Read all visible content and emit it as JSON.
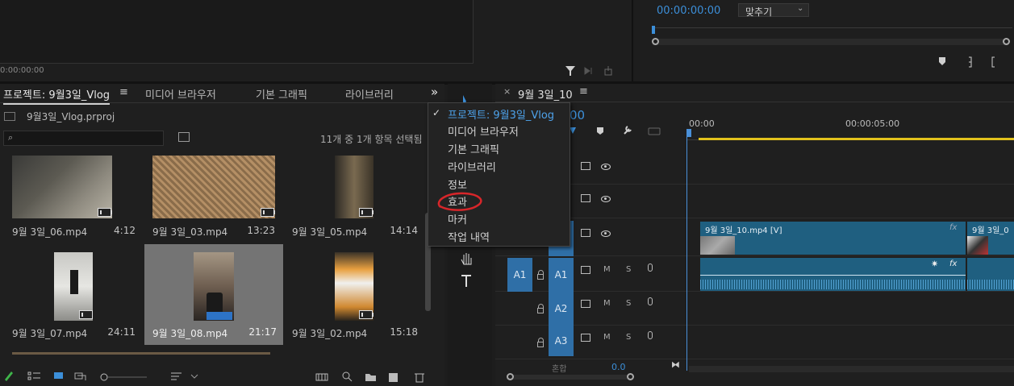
{
  "program_monitor": {
    "timecode": "00:00:00:00",
    "fit_label": "맞추기",
    "left_timecode": "0:00:00:00"
  },
  "project_panel": {
    "tabs": [
      {
        "label": "프로젝트: 9월3일_Vlog"
      },
      {
        "label": "미디어 브라우저"
      },
      {
        "label": "기본 그래픽"
      },
      {
        "label": "라이브러리"
      }
    ],
    "overflow_symbol": "»",
    "file_name": "9월3일_Vlog.prproj",
    "search_placeholder": "",
    "selection_info": "11개 중 1개 항목 선택됨",
    "clips": [
      {
        "name": "9월 3일_06.mp4",
        "duration": "4:12"
      },
      {
        "name": "9월 3일_03.mp4",
        "duration": "13:23"
      },
      {
        "name": "9월 3일_05.mp4",
        "duration": "14:14"
      },
      {
        "name": "9월 3일_07.mp4",
        "duration": "24:11"
      },
      {
        "name": "9월 3일_08.mp4",
        "duration": "21:17"
      },
      {
        "name": "9월 3일_02.mp4",
        "duration": "15:18"
      }
    ]
  },
  "panel_menu": {
    "items": [
      {
        "label": "프로젝트: 9월3일_Vlog",
        "checked": true
      },
      {
        "label": "미디어 브라우저"
      },
      {
        "label": "기본 그래픽"
      },
      {
        "label": "라이브러리"
      },
      {
        "label": "정보"
      },
      {
        "label": "효과",
        "annotated": true
      },
      {
        "label": "마커"
      },
      {
        "label": "작업 내역"
      }
    ],
    "annotation_color": "#d8262a"
  },
  "timeline": {
    "sequence_name": "9월 3일_10",
    "timecode_partial": "00",
    "ruler": [
      "00:00",
      "00:00:05:00"
    ],
    "track_v_clip_label": "9월 3일_10.mp4 [V]",
    "track_v_clip2_label": "9월 3일_0",
    "fx_label": "fx",
    "tracks": {
      "a1_source": "A1",
      "a1": "A1",
      "a2": "A2",
      "a3": "A3",
      "mute": "M",
      "solo": "S"
    },
    "mix_label": "혼합",
    "mix_value": "0.0"
  },
  "colors": {
    "accent_blue": "#3c8fd9",
    "clip_blue": "#1f5f80",
    "playhead": "#4a90d9",
    "work_area": "#e2c21c"
  }
}
